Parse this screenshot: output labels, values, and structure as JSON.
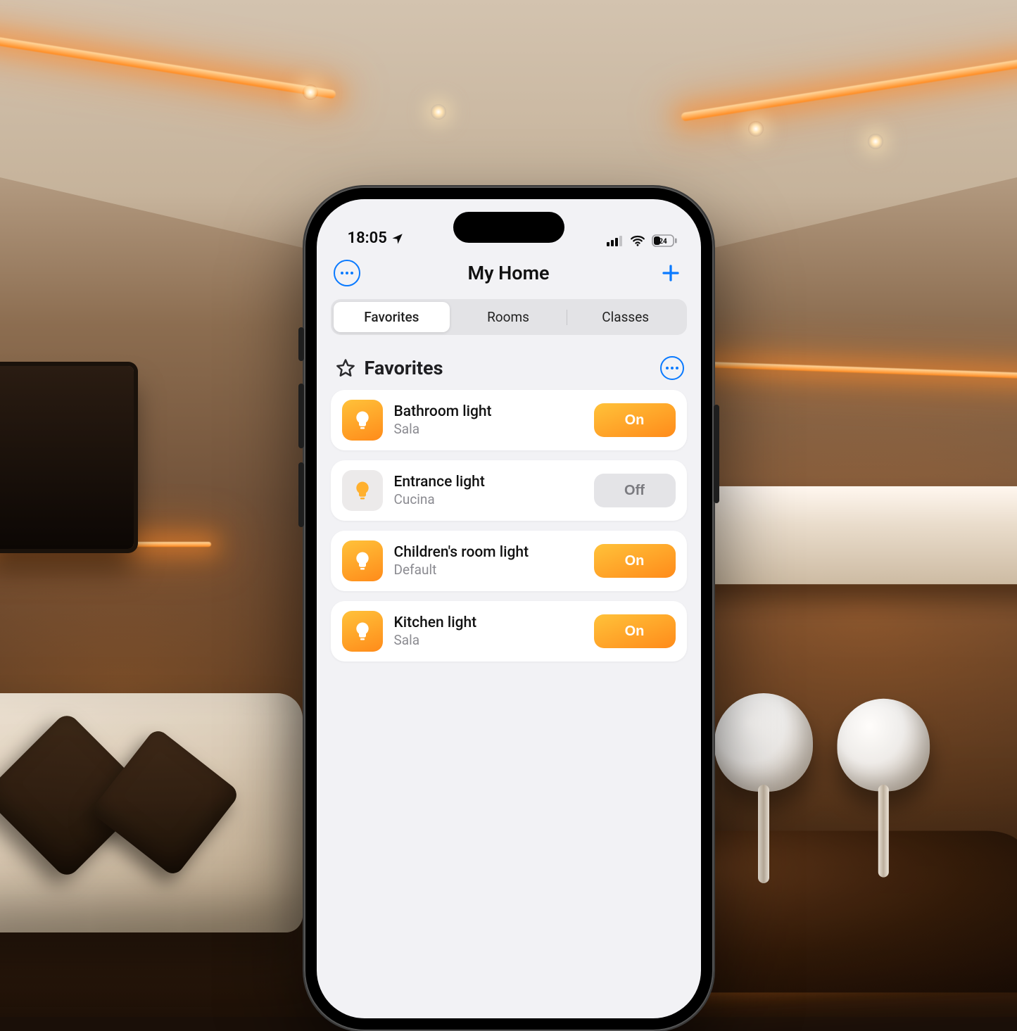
{
  "status_bar": {
    "time": "18:05",
    "battery_text": "24"
  },
  "header": {
    "title": "My Home"
  },
  "tabs": {
    "items": [
      "Favorites",
      "Rooms",
      "Classes"
    ],
    "active_index": 0
  },
  "section": {
    "title": "Favorites"
  },
  "state_labels": {
    "on": "On",
    "off": "Off"
  },
  "devices": [
    {
      "name": "Bathroom light",
      "room": "Sala",
      "state": "on"
    },
    {
      "name": "Entrance light",
      "room": "Cucina",
      "state": "off"
    },
    {
      "name": "Children's room light",
      "room": "Default",
      "state": "on"
    },
    {
      "name": "Kitchen light",
      "room": "Sala",
      "state": "on"
    }
  ],
  "colors": {
    "accent_blue": "#0a7aff",
    "gradient_start": "#ffc23a",
    "gradient_end": "#ff8b1a",
    "off_bg": "#e4e4e7"
  }
}
